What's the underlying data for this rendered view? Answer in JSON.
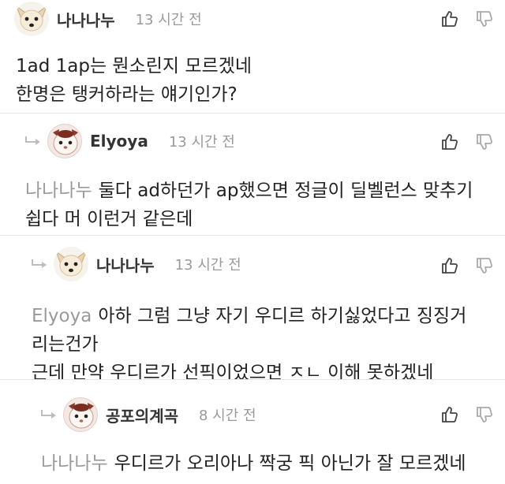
{
  "comments": [
    {
      "nickname": "나나나누",
      "time": "13 시간 전",
      "avatar": "chihuahua-avatar",
      "reply": false,
      "lines": [
        "1ad 1ap는 뭔소린지 모르겠네",
        "한명은 탱커하라는 얘기인가?"
      ]
    },
    {
      "nickname": "Elyoya",
      "time": "13 시간 전",
      "avatar": "cat-avatar",
      "reply": true,
      "mention": "나나나누",
      "lines": [
        "둘다 ad하던가 ap했으면 정글이 딜벨런스 맞추기",
        "쉽다 머 이런거 같은데"
      ]
    },
    {
      "nickname": "나나나누",
      "time": "13 시간 전",
      "avatar": "chihuahua-avatar",
      "reply": true,
      "mention": "Elyoya",
      "lines": [
        "아하 그럼 그냥 자기 우디르 하기싫었다고 징징거",
        "리는건가",
        "근데 만약 우디르가 선픽이었으면 ㅈㄴ 이해 못하겠네"
      ]
    },
    {
      "nickname": "공포의계곡",
      "time": "8 시간 전",
      "avatar": "cat-avatar",
      "reply": true,
      "mention": "나나나누",
      "lines": [
        "우디르가 오리아나 짝궁 픽 아닌가 잘 모르겠네"
      ]
    }
  ],
  "icons": {
    "like": "thumbs-up-icon",
    "dislike": "thumbs-down-icon",
    "reply": "reply-arrow-icon"
  },
  "colors": {
    "text": "#222222",
    "meta": "#9a9a9a",
    "divider": "#e6e6e6"
  }
}
